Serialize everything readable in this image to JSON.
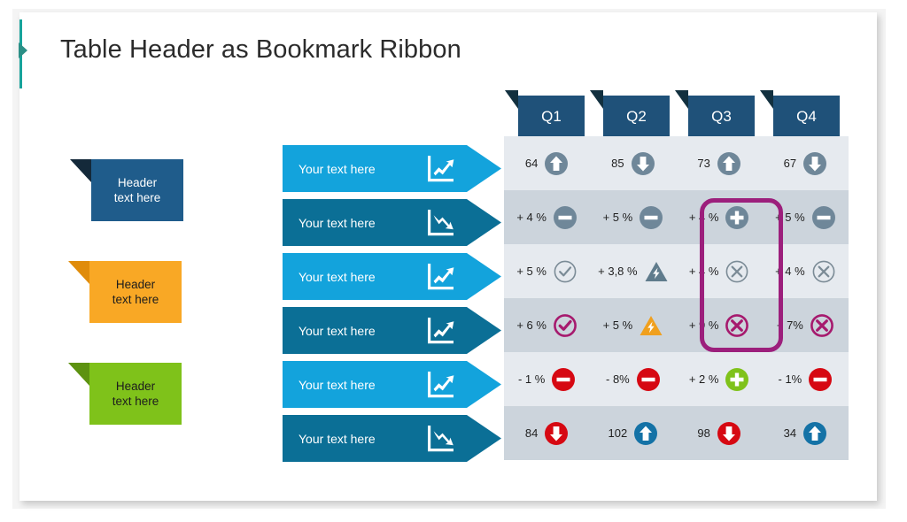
{
  "title": "Table Header as Bookmark Ribbon",
  "colors": {
    "accent_teal": "#17a39b",
    "ribbon_light": "#13a3dc",
    "ribbon_dark": "#0b6f96",
    "header_blue": "#1f5179",
    "header_fold": "#12303f",
    "bookmark_blue": "#1f5c8b",
    "bookmark_orange": "#f9a825",
    "bookmark_green": "#7fc21a",
    "row_odd": "#e6eaef",
    "row_even": "#ccd4dc",
    "highlight_magenta": "#9c1f7c",
    "status_red": "#d60812",
    "status_green": "#7fc21a",
    "status_blue": "#1472a6",
    "status_gray": "#6f8799"
  },
  "left_bookmarks": [
    {
      "line1": "Header",
      "line2": "text here",
      "color": "blue"
    },
    {
      "line1": "Header",
      "line2": "text here",
      "color": "orange"
    },
    {
      "line1": "Header",
      "line2": "text here",
      "color": "green"
    }
  ],
  "row_ribbons": [
    {
      "label": "Your text here",
      "shade": "light",
      "trend": "chart-up-icon"
    },
    {
      "label": "Your text here",
      "shade": "dark",
      "trend": "chart-down-icon"
    },
    {
      "label": "Your text here",
      "shade": "light",
      "trend": "chart-up-icon"
    },
    {
      "label": "Your text here",
      "shade": "dark",
      "trend": "chart-up-icon"
    },
    {
      "label": "Your text here",
      "shade": "light",
      "trend": "chart-up-icon"
    },
    {
      "label": "Your text here",
      "shade": "dark",
      "trend": "chart-down-icon"
    }
  ],
  "table": {
    "columns": [
      "Q1",
      "Q2",
      "Q3",
      "Q4"
    ],
    "rows": [
      {
        "stripe": "odd",
        "cells": [
          {
            "value": "64",
            "icon": "arrow-up-circle-icon",
            "icon_color": "gray"
          },
          {
            "value": "85",
            "icon": "arrow-down-circle-icon",
            "icon_color": "gray"
          },
          {
            "value": "73",
            "icon": "arrow-up-circle-icon",
            "icon_color": "gray"
          },
          {
            "value": "67",
            "icon": "arrow-down-circle-icon",
            "icon_color": "gray"
          }
        ]
      },
      {
        "stripe": "even",
        "cells": [
          {
            "value": "+ 4 %",
            "icon": "minus-circle-icon",
            "icon_color": "gray"
          },
          {
            "value": "+ 5 %",
            "icon": "minus-circle-icon",
            "icon_color": "gray"
          },
          {
            "value": "+ 4 %",
            "icon": "plus-circle-icon",
            "icon_color": "gray"
          },
          {
            "value": "+ 5 %",
            "icon": "minus-circle-icon",
            "icon_color": "gray"
          }
        ]
      },
      {
        "stripe": "odd",
        "cells": [
          {
            "value": "+ 5 %",
            "icon": "check-circle-outline-icon",
            "icon_color": "gray"
          },
          {
            "value": "+ 3,8 %",
            "icon": "warning-bolt-triangle-icon",
            "icon_color": "gray"
          },
          {
            "value": "+ 4 %",
            "icon": "x-circle-outline-icon",
            "icon_color": "gray"
          },
          {
            "value": "+ 4 %",
            "icon": "x-circle-outline-icon",
            "icon_color": "gray"
          }
        ]
      },
      {
        "stripe": "even",
        "cells": [
          {
            "value": "+ 6 %",
            "icon": "check-circle-outline-icon",
            "icon_color": "magenta"
          },
          {
            "value": "+ 5 %",
            "icon": "warning-bolt-triangle-icon",
            "icon_color": "orange"
          },
          {
            "value": "+ 9 %",
            "icon": "x-circle-outline-icon",
            "icon_color": "magenta"
          },
          {
            "value": "+ 7%",
            "icon": "x-circle-outline-icon",
            "icon_color": "magenta"
          }
        ]
      },
      {
        "stripe": "odd",
        "cells": [
          {
            "value": "- 1 %",
            "icon": "minus-circle-icon",
            "icon_color": "red"
          },
          {
            "value": "- 8%",
            "icon": "minus-circle-icon",
            "icon_color": "red"
          },
          {
            "value": "+ 2 %",
            "icon": "plus-circle-icon",
            "icon_color": "green"
          },
          {
            "value": "- 1%",
            "icon": "minus-circle-icon",
            "icon_color": "red"
          }
        ]
      },
      {
        "stripe": "even",
        "cells": [
          {
            "value": "84",
            "icon": "arrow-down-circle-icon",
            "icon_color": "red"
          },
          {
            "value": "102",
            "icon": "arrow-up-circle-icon",
            "icon_color": "blue"
          },
          {
            "value": "98",
            "icon": "arrow-down-circle-icon",
            "icon_color": "red"
          },
          {
            "value": "34",
            "icon": "arrow-up-circle-icon",
            "icon_color": "blue"
          }
        ]
      }
    ]
  },
  "highlight": {
    "name": "q3-highlight-box",
    "column": "Q3",
    "rows": [
      2,
      3,
      4
    ]
  }
}
